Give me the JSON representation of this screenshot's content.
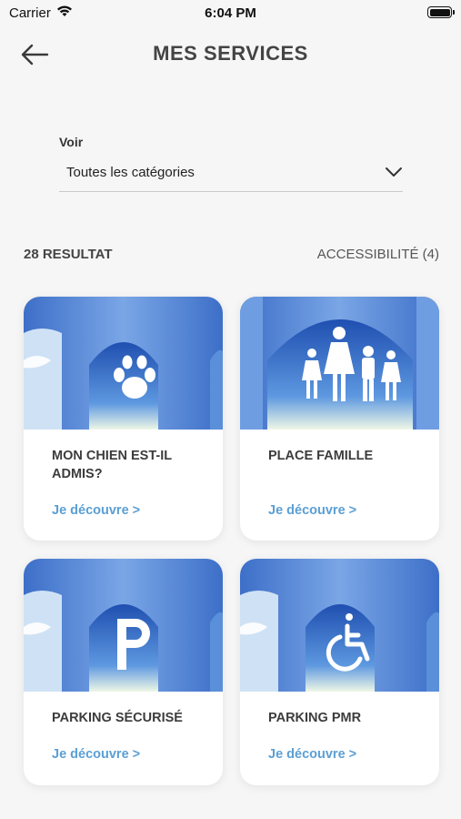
{
  "status_bar": {
    "carrier": "Carrier",
    "time": "6:04 PM"
  },
  "header": {
    "title": "MES SERVICES"
  },
  "filter": {
    "label": "Voir",
    "value": "Toutes les catégories"
  },
  "results": {
    "count_label": "28 RESULTAT",
    "category_label": "ACCESSIBILITÉ (4)"
  },
  "cards": [
    {
      "title": "MON CHIEN EST-IL ADMIS?",
      "link": "Je découvre >",
      "icon": "paw-icon"
    },
    {
      "title": "PLACE FAMILLE",
      "link": "Je découvre >",
      "icon": "family-icon"
    },
    {
      "title": "PARKING SÉCURISÉ",
      "link": "Je découvre >",
      "icon": "parking-icon"
    },
    {
      "title": "PARKING PMR",
      "link": "Je découvre >",
      "icon": "wheelchair-icon"
    }
  ],
  "colors": {
    "accent": "#5b9fd4",
    "background": "#f6f6f6",
    "sky_blue": "#2f5fb8"
  }
}
